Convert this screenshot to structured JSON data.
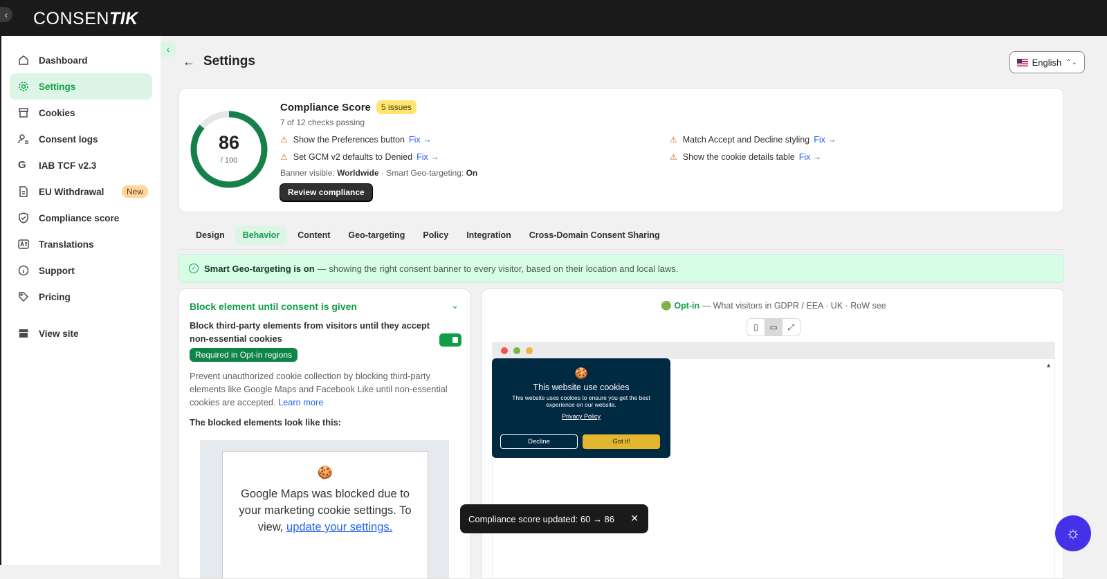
{
  "app": {
    "logo_main": "CONSEN",
    "logo_tail": "TIK"
  },
  "sidebar": {
    "items": [
      {
        "label": "Dashboard"
      },
      {
        "label": "Settings"
      },
      {
        "label": "Cookies"
      },
      {
        "label": "Consent logs"
      },
      {
        "label": "IAB TCF v2.3"
      },
      {
        "label": "EU Withdrawal",
        "badge": "New"
      },
      {
        "label": "Compliance score"
      },
      {
        "label": "Translations"
      },
      {
        "label": "Support"
      },
      {
        "label": "Pricing"
      },
      {
        "label": "View site"
      }
    ]
  },
  "header": {
    "title": "Settings",
    "language": "English"
  },
  "score": {
    "value": "86",
    "max": "/ 100",
    "fraction": 0.86,
    "title": "Compliance Score",
    "issues": "5 issues",
    "subtitle": "7 of 12 checks passing",
    "checks": [
      {
        "label": "Show the Preferences button",
        "fix": "Fix →"
      },
      {
        "label": "Set GCM v2 defaults to Denied",
        "fix": "Fix →"
      },
      {
        "label": "Match Accept and Decline styling",
        "fix": "Fix →"
      },
      {
        "label": "Show the cookie details table",
        "fix": "Fix →"
      }
    ],
    "banner_label": "Banner visible:",
    "banner_value": "Worldwide",
    "geo_label": "· Smart Geo-targeting:",
    "geo_value": "On",
    "review_button": "Review compliance"
  },
  "tabs": [
    "Design",
    "Behavior",
    "Content",
    "Geo-targeting",
    "Policy",
    "Integration",
    "Cross-Domain Consent Sharing"
  ],
  "geo_banner": {
    "bold": "Smart Geo-targeting is on",
    "text": "— showing the right consent banner to every visitor, based on their location and local laws."
  },
  "block": {
    "title": "Block element until consent is given",
    "description": "Block third-party elements from visitors until they accept non-essential cookies",
    "required_badge": "Required in Opt-in regions",
    "paragraph": "Prevent unauthorized cookie collection by blocking third-party elements like Google Maps and Facebook Like until non-essential cookies are accepted.",
    "learn_more": "Learn more",
    "blocked_heading": "The blocked elements look like this:",
    "blocked_msg": "Google Maps was blocked due to your marketing cookie settings. To view,",
    "blocked_link": "update your settings."
  },
  "preview": {
    "mode_label": "Opt-in",
    "mode_desc": "— What visitors in GDPR / EEA · UK · RoW see",
    "banner": {
      "title": "This website use cookies",
      "text": "This website uses cookies to ensure you get the best experience on our website.",
      "policy": "Privacy Policy",
      "decline": "Decline",
      "accept": "Got it!"
    }
  },
  "toast": {
    "text": "Compliance score updated: 60 → 86"
  },
  "colors": {
    "accent": "#109e48",
    "active_bg": "#dcf5e6",
    "banner_bg": "#002942",
    "accept_btn": "#e2b62f",
    "topbar": "#1a1a1a",
    "fab": "#4431e8"
  }
}
